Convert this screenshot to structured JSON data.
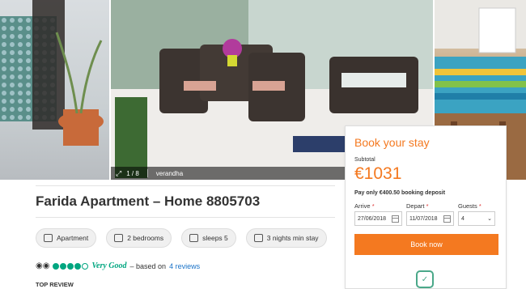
{
  "gallery": {
    "counter": "1 / 8",
    "caption": "verandha"
  },
  "listing": {
    "title": "Farida Apartment – Home 8805703",
    "features": [
      "Apartment",
      "2 bedrooms",
      "sleeps 5",
      "3 nights min stay"
    ]
  },
  "reviews": {
    "rating_text": "Very Good",
    "based_on": "– based on",
    "count_link": "4 reviews",
    "rating_dots": 4,
    "top_review_heading": "TOP REVIEW"
  },
  "booking": {
    "heading": "Book your stay",
    "subtotal_label": "Subtotal",
    "price": "€1031",
    "deposit": "Pay only €400.50 booking deposit",
    "arrive_label": "Arrive",
    "arrive_value": "27/06/2018",
    "depart_label": "Depart",
    "depart_value": "11/07/2018",
    "guests_label": "Guests",
    "guests_value": "4",
    "required_mark": "*",
    "book_button": "Book now"
  },
  "colors": {
    "accent": "#f47920",
    "tripadvisor": "#00a680",
    "link": "#1a73c8"
  }
}
